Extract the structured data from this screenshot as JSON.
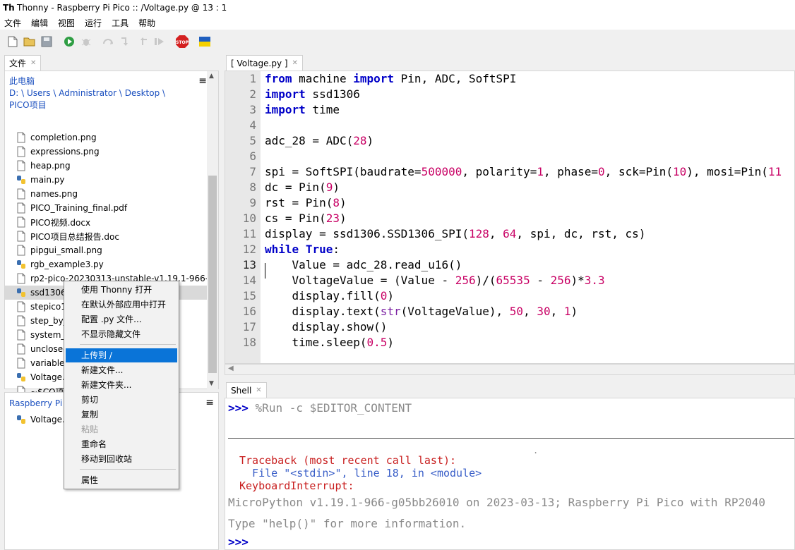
{
  "window": {
    "title": "Thonny  -  Raspberry Pi Pico :: /Voltage.py  @  13 : 1",
    "logo_text": "Th"
  },
  "menu": [
    "文件",
    "编辑",
    "视图",
    "运行",
    "工具",
    "帮助"
  ],
  "toolbar": {
    "icons": [
      "new-file-icon",
      "open-file-icon",
      "save-icon",
      "run-icon",
      "debug-icon",
      "step-over-icon",
      "step-into-icon",
      "step-out-icon",
      "resume-icon",
      "stop-icon",
      "flag-icon"
    ],
    "stop_label": "STOP"
  },
  "files_panel": {
    "tab_label": "文件",
    "path_line1": "此电脑",
    "path_line2": "D: \\ Users \\ Administrator \\ Desktop \\",
    "path_line3": "PICO项目",
    "menu_glyph": "≡",
    "items": [
      {
        "name": "completion.png",
        "type": "file"
      },
      {
        "name": "expressions.png",
        "type": "file"
      },
      {
        "name": "heap.png",
        "type": "file"
      },
      {
        "name": "main.py",
        "type": "python"
      },
      {
        "name": "names.png",
        "type": "file"
      },
      {
        "name": "PICO_Training_final.pdf",
        "type": "file"
      },
      {
        "name": "PICO视频.docx",
        "type": "file"
      },
      {
        "name": "PICO项目总结报告.doc",
        "type": "file"
      },
      {
        "name": "pipgui_small.png",
        "type": "file"
      },
      {
        "name": "rgb_example3.py",
        "type": "python"
      },
      {
        "name": "rp2-pico-20230313-unstable-v1.19.1-966-g",
        "type": "file"
      },
      {
        "name": "ssd1306.py",
        "type": "python"
      },
      {
        "name": "stepico1",
        "type": "file"
      },
      {
        "name": "step_by_",
        "type": "file"
      },
      {
        "name": "system_s",
        "type": "file"
      },
      {
        "name": "unclosed",
        "type": "file"
      },
      {
        "name": "variable",
        "type": "file"
      },
      {
        "name": "Voltage.",
        "type": "python"
      },
      {
        "name": "~$CO项",
        "type": "file"
      }
    ]
  },
  "device_panel": {
    "title": "Raspberry Pi",
    "menu_glyph": "≡",
    "file": "Voltage."
  },
  "editor": {
    "tab_label": "[ Voltage.py ]",
    "line_numbers": [
      "1",
      "2",
      "3",
      "4",
      "5",
      "6",
      "7",
      "8",
      "9",
      "10",
      "11",
      "12",
      "13",
      "14",
      "15",
      "16",
      "17",
      "18"
    ]
  },
  "shell": {
    "tab_label": "Shell",
    "run_prompt": ">>>",
    "run_command": "%Run -c $EDITOR_CONTENT",
    "dot": ".",
    "traceback_line1": "Traceback (most recent call last):",
    "traceback_line2": "  File \"<stdin>\", line 18, in <module>",
    "traceback_line3": "KeyboardInterrupt:",
    "banner": "MicroPython v1.19.1-966-g05bb26010 on 2023-03-13; Raspberry Pi Pico with RP2040",
    "help_text": "Type \"help()\" for more information.",
    "final_prompt": ">>>"
  },
  "context_menu": {
    "items": [
      "使用 Thonny 打开",
      "在默认外部应用中打开",
      "配置 .py 文件...",
      "不显示隐藏文件",
      "上传到 /",
      "新建文件...",
      "新建文件夹...",
      "剪切",
      "复制",
      "粘贴",
      "重命名",
      "移动到回收站",
      "属性"
    ]
  },
  "colors": {
    "keyword": "#0000c8",
    "number": "#c80064",
    "highlight": "#0a74d8",
    "link": "#1a4fbf",
    "error": "#c81e1e"
  }
}
